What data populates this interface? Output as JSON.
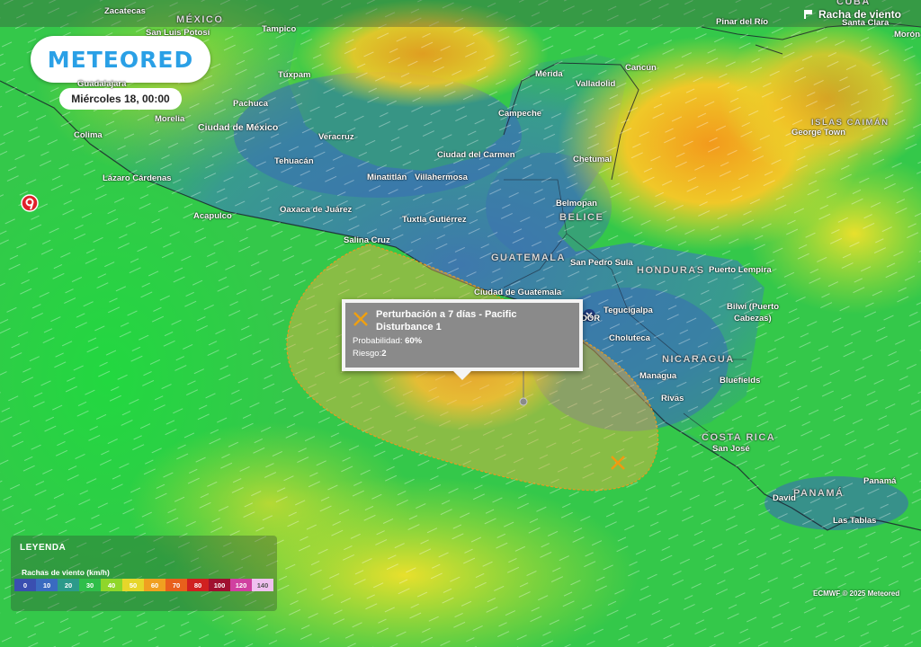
{
  "app": {
    "logo_text": "METEORED",
    "date_label": "Miércoles 18, 00:00",
    "layer_title": "Racha de viento",
    "credit": "ECMWF © 2025 Meteored"
  },
  "colors": {
    "sea_low": "#3a6bb8",
    "sea_mid": "#2fd44a",
    "sea_high": "#e6e02a",
    "hot": "#f0a020",
    "cone": "#f0b040",
    "accent": "#2aa0e6"
  },
  "icons": {
    "pin": "meteored-location-pin-icon",
    "disturbance": "x-mark-icon",
    "layer": "flag-icon"
  },
  "map_labels": {
    "zacatecas": "Zacatecas",
    "mexico": "MÉXICO",
    "san_luis_potosi": "San Luis Potosí",
    "tampico": "Tampico",
    "guadalajara": "Guadalajara",
    "tuxpam": "Túxpam",
    "pachuca": "Pachuca",
    "morelia": "Morelia",
    "ciudad_de_mexico": "Ciudad de México",
    "colima": "Colima",
    "veracruz": "Veracruz",
    "tehuacan": "Tehuacán",
    "lazaro_cardenas": "Lázaro Cárdenas",
    "minatitlan": "Minatitlán",
    "villahermosa": "Villahermosa",
    "acapulco": "Acapulco",
    "oaxaca": "Oaxaca de Juárez",
    "tuxtla": "Tuxtla Gutiérrez",
    "salina_cruz": "Salina Cruz",
    "merida": "Mérida",
    "valladolid": "Valladolid",
    "cancun": "Cancún",
    "campeche": "Campeche",
    "ciudad_del_carmen": "Ciudad del Carmen",
    "chetumal": "Chetumal",
    "belmopan": "Belmopan",
    "belice": "BELICE",
    "guatemala": "GUATEMALA",
    "san_pedro_sula": "San Pedro Sula",
    "honduras": "HONDURAS",
    "ciudad_de_guatemala": "Ciudad de Guatemala",
    "tegucigalpa": "Tegucigalpa",
    "choluteca": "Choluteca",
    "puerto_lempira": "Puerto Lempira",
    "bilwi": "Bilwi (Puerto",
    "cabezas": "Cabezas)",
    "nicaragua": "NICARAGUA",
    "managua": "Managua",
    "bluefields": "Bluefields",
    "rivas": "Rivas",
    "costa_rica": "COSTA RICA",
    "san_jose": "San José",
    "panama_country": "PANAMÁ",
    "panama_city": "Panamá",
    "david": "David",
    "las_tablas": "Las Tablas",
    "pinar_del_rio": "Pinar del Río",
    "cuba": "CUBA",
    "santa_clara": "Santa Clara",
    "moron": "Morón",
    "islas_caiman": "ISLAS CAIMÁN",
    "george_town": "George Town",
    "el_salvador_fragment": "DOR"
  },
  "popup": {
    "title": "Perturbación a 7 días - Pacific Disturbance 1",
    "probability_label": "Probabilidad:",
    "probability_value": "60%",
    "risk_label": "Riesgo:",
    "risk_value": "2"
  },
  "legend": {
    "title": "LEYENDA",
    "subtitle": "Rachas de viento (km/h)",
    "bins": [
      {
        "label": "0",
        "color": "#3a4fb0"
      },
      {
        "label": "10",
        "color": "#3a6bc0"
      },
      {
        "label": "20",
        "color": "#2c9a8a"
      },
      {
        "label": "30",
        "color": "#2fbe4a"
      },
      {
        "label": "40",
        "color": "#8fd62a"
      },
      {
        "label": "50",
        "color": "#e6d62a"
      },
      {
        "label": "60",
        "color": "#f0a020"
      },
      {
        "label": "70",
        "color": "#e8601c"
      },
      {
        "label": "80",
        "color": "#d02020"
      },
      {
        "label": "100",
        "color": "#a01030"
      },
      {
        "label": "120",
        "color": "#d040a0"
      },
      {
        "label": "140",
        "color": "#f0c0f0"
      }
    ]
  }
}
